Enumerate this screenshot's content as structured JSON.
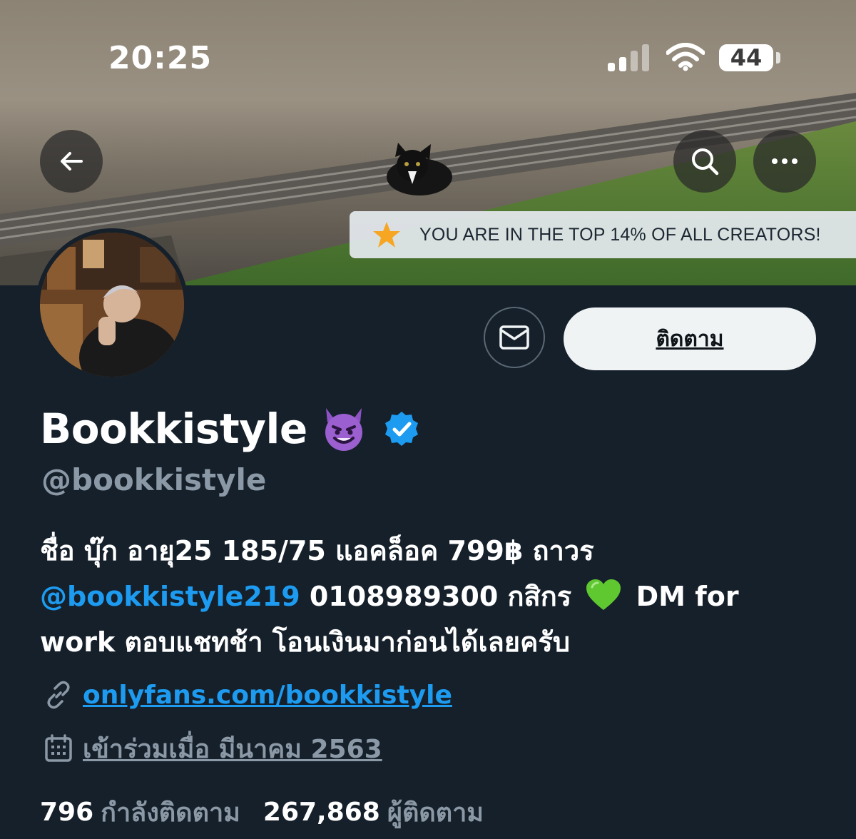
{
  "status_bar": {
    "time": "20:25",
    "battery": "44"
  },
  "banner": {
    "notice": "YOU ARE IN THE TOP 14% OF ALL CREATORS!",
    "notice_icon": "star-icon"
  },
  "actions": {
    "follow_label": "ติดตาม",
    "message_icon": "mail-icon"
  },
  "profile": {
    "display_name": "Bookkistyle",
    "name_emoji": "smiling-devil-emoji",
    "verified": true,
    "handle": "@bookkistyle",
    "bio_line1": "ชื่อ บุ๊ก อายุ25 185/75 แอคล็อค 799฿ ถาวร",
    "bio_mention": "@bookkistyle219",
    "bio_line2_rest": " 0108989300 กสิกร",
    "bio_line2_tail": " DM for",
    "bio_line3": "work ตอบแชทช้า โอนเงินมาก่อนได้เลยครับ",
    "link": "onlyfans.com/bookkistyle",
    "joined": "เข้าร่วมเมื่อ มีนาคม 2563",
    "following_count": "796",
    "following_label": "กำลังติดตาม",
    "followers_count": "267,868",
    "followers_label": "ผู้ติดตาม"
  },
  "colors": {
    "background": "#15202b",
    "accent": "#1d9bf0",
    "secondary_text": "#8b98a5"
  }
}
